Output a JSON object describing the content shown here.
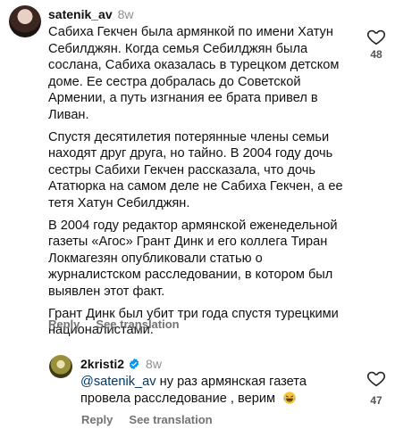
{
  "comment1": {
    "username": "satenik_av",
    "time": "8w",
    "paragraphs": [
      "Сабиха Гекчен была армянкой по имени Хатун Себилджян. Когда семья Себилджян была сослана, Сабиха оказалась в турецком детском доме. Ее сестра добралась до Советской Армении, а путь изгнания ее брата привел в Ливан.",
      "Спустя десятилетия потерянные члены семьи находят друг друга, но тайно. В 2004 году дочь сестры Сабихи Гекчен рассказала, что дочь Ататюрка на самом деле не Сабиха Гекчен, а ее тетя Хатун Себилджян.",
      "В 2004 году редактор армянской еженедельной газеты «Агос» Грант Динк и его коллега Тиран Локмагезян опубликовали статью о журналистском расследовании, в котором был выявлен этот факт.",
      "Грант Динк был убит три года спустя турецкими националистами."
    ],
    "reply_label": "Reply",
    "see_translation_label": "See translation",
    "likes": "48"
  },
  "comment2": {
    "username": "2kristi2",
    "time": "8w",
    "mention": "@satenik_av",
    "text": "ну раз армянская газета провела расследование , верим",
    "emoji": "laughing-tears",
    "reply_label": "Reply",
    "see_translation_label": "See translation",
    "likes": "47"
  },
  "colors": {
    "muted": "#8e8e8e",
    "mention": "#00376b",
    "verified": "#0095f6"
  }
}
